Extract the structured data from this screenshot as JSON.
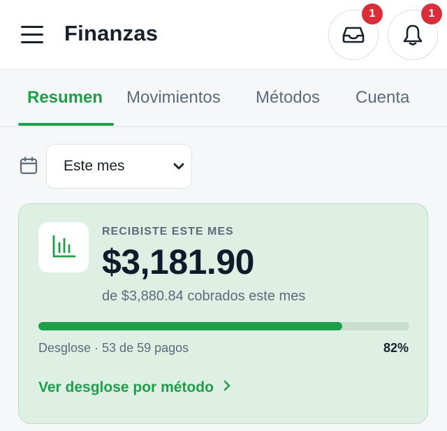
{
  "header": {
    "title": "Finanzas",
    "icons": {
      "menu": "hamburger-menu-icon",
      "inbox": "inbox-tray-icon",
      "bell": "bell-icon"
    },
    "inbox_badge": "1",
    "notifications_badge": "1"
  },
  "tabs": [
    {
      "label": "Resumen",
      "active": true
    },
    {
      "label": "Movimientos",
      "active": false
    },
    {
      "label": "Métodos",
      "active": false
    },
    {
      "label": "Cuenta",
      "active": false
    }
  ],
  "filter": {
    "icon": "calendar-icon",
    "period_value": "Este mes"
  },
  "summary_card": {
    "label": "RECIBISTE ESTE MES",
    "amount": "$3,181.90",
    "subtitle": "de $3,880.84 cobrados este mes",
    "progress_fraction": 0.82,
    "breakdown_text": "Desglose · 53 de 59 pagos",
    "percent_text": "82%",
    "link_label": "Ver desglose por método",
    "icon": "bar-chart-icon"
  },
  "colors": {
    "accent": "#1f9e4a",
    "badge": "#d92d3a",
    "card_bg": "#ddf0e3",
    "text_primary": "#17202b",
    "text_secondary": "#5c6b7a"
  }
}
